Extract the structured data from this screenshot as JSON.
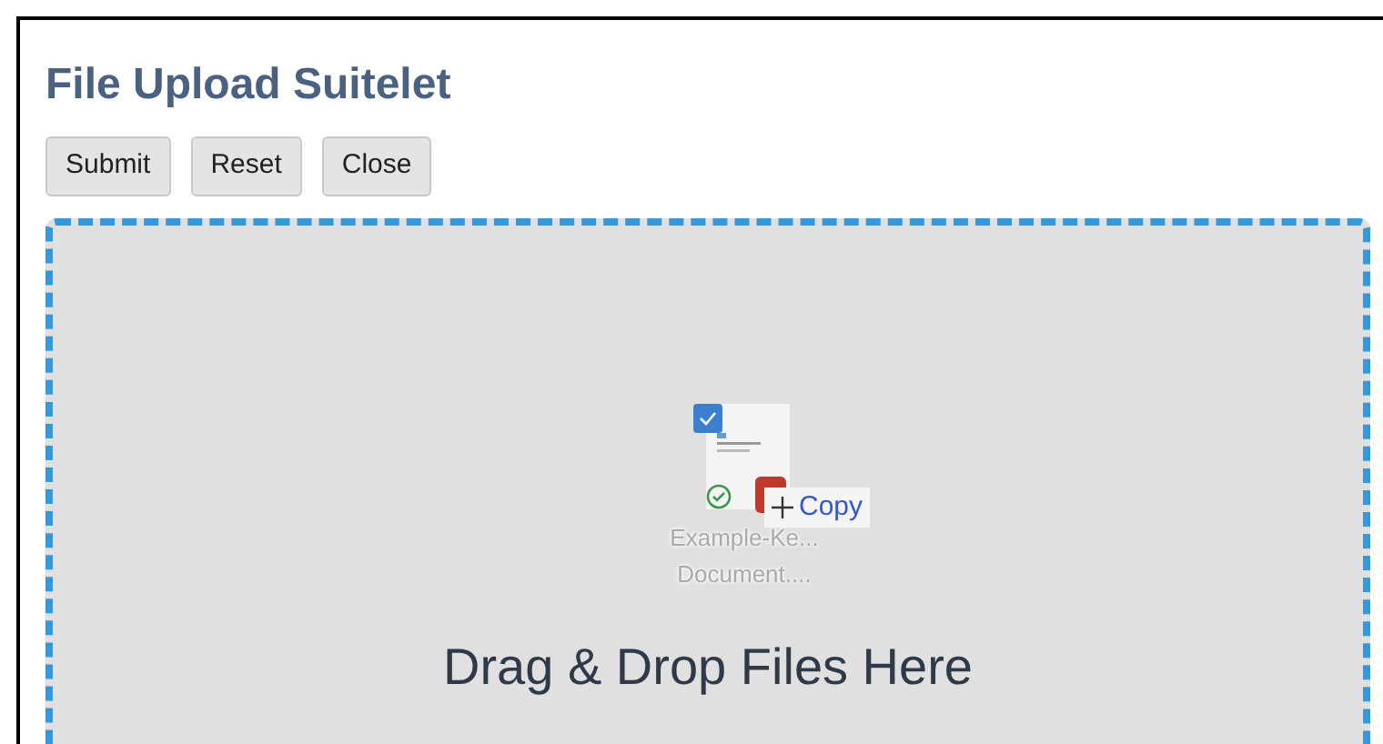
{
  "title": "File Upload Suitelet",
  "buttons": [
    "Submit",
    "Reset",
    "Close"
  ],
  "dropzone": {
    "label": "Drag & Drop Files Here",
    "drag_preview": {
      "checked": true,
      "file_name_lines": [
        "Example-Ke...",
        "Document...."
      ],
      "tooltip": "Copy"
    }
  }
}
